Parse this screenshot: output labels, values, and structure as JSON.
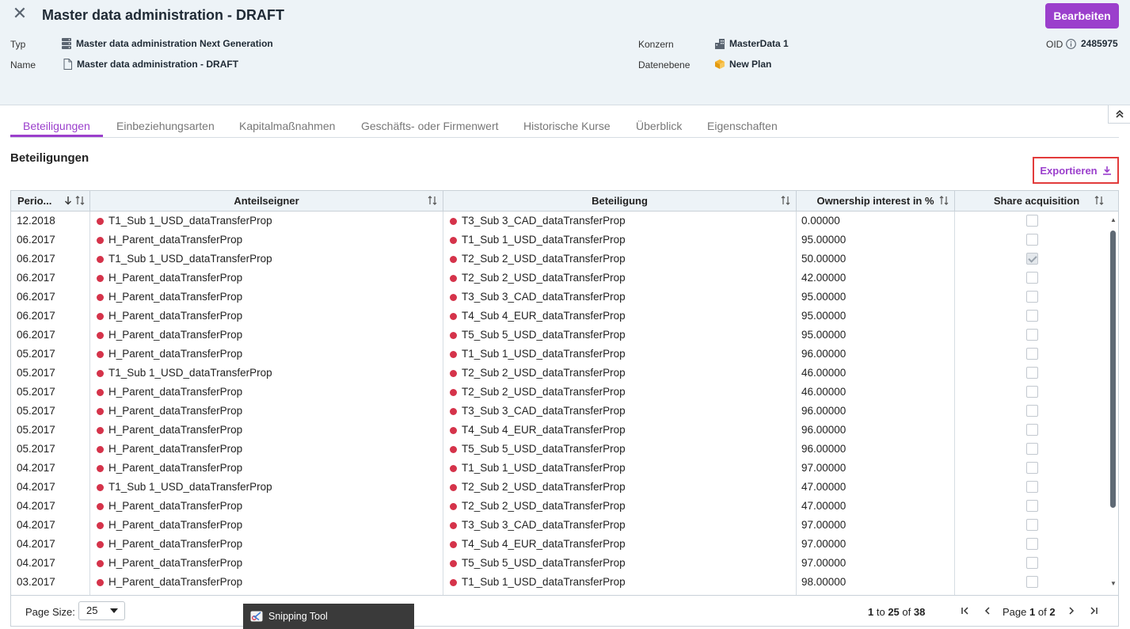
{
  "header": {
    "title": "Master data administration - DRAFT",
    "edit_button": "Bearbeiten",
    "meta": {
      "typ_label": "Typ",
      "typ_value": "Master data administration Next Generation",
      "name_label": "Name",
      "name_value": "Master data administration - DRAFT",
      "konzern_label": "Konzern",
      "konzern_value": "MasterData 1",
      "datenebene_label": "Datenebene",
      "datenebene_value": "New Plan",
      "oid_label": "OID",
      "oid_value": "2485975"
    }
  },
  "tabs": [
    "Beteiligungen",
    "Einbeziehungsarten",
    "Kapitalmaßnahmen",
    "Geschäfts- oder Firmenwert",
    "Historische Kurse",
    "Überblick",
    "Eigenschaften"
  ],
  "active_tab": "Beteiligungen",
  "section_title": "Beteiligungen",
  "export_label": "Exportieren",
  "grid": {
    "columns": [
      "Perio...",
      "Anteilseigner",
      "Beteiligung",
      "Ownership interest in %",
      "Share acquisition"
    ],
    "rows": [
      {
        "period": "12.2018",
        "owner": "T1_Sub 1_USD_dataTransferProp",
        "holding": "T3_Sub 3_CAD_dataTransferProp",
        "pct": "0.00000",
        "acq": false
      },
      {
        "period": "06.2017",
        "owner": "H_Parent_dataTransferProp",
        "holding": "T1_Sub 1_USD_dataTransferProp",
        "pct": "95.00000",
        "acq": false
      },
      {
        "period": "06.2017",
        "owner": "T1_Sub 1_USD_dataTransferProp",
        "holding": "T2_Sub 2_USD_dataTransferProp",
        "pct": "50.00000",
        "acq": true
      },
      {
        "period": "06.2017",
        "owner": "H_Parent_dataTransferProp",
        "holding": "T2_Sub 2_USD_dataTransferProp",
        "pct": "42.00000",
        "acq": false
      },
      {
        "period": "06.2017",
        "owner": "H_Parent_dataTransferProp",
        "holding": "T3_Sub 3_CAD_dataTransferProp",
        "pct": "95.00000",
        "acq": false
      },
      {
        "period": "06.2017",
        "owner": "H_Parent_dataTransferProp",
        "holding": "T4_Sub 4_EUR_dataTransferProp",
        "pct": "95.00000",
        "acq": false
      },
      {
        "period": "06.2017",
        "owner": "H_Parent_dataTransferProp",
        "holding": "T5_Sub 5_USD_dataTransferProp",
        "pct": "95.00000",
        "acq": false
      },
      {
        "period": "05.2017",
        "owner": "H_Parent_dataTransferProp",
        "holding": "T1_Sub 1_USD_dataTransferProp",
        "pct": "96.00000",
        "acq": false
      },
      {
        "period": "05.2017",
        "owner": "T1_Sub 1_USD_dataTransferProp",
        "holding": "T2_Sub 2_USD_dataTransferProp",
        "pct": "46.00000",
        "acq": false
      },
      {
        "period": "05.2017",
        "owner": "H_Parent_dataTransferProp",
        "holding": "T2_Sub 2_USD_dataTransferProp",
        "pct": "46.00000",
        "acq": false
      },
      {
        "period": "05.2017",
        "owner": "H_Parent_dataTransferProp",
        "holding": "T3_Sub 3_CAD_dataTransferProp",
        "pct": "96.00000",
        "acq": false
      },
      {
        "period": "05.2017",
        "owner": "H_Parent_dataTransferProp",
        "holding": "T4_Sub 4_EUR_dataTransferProp",
        "pct": "96.00000",
        "acq": false
      },
      {
        "period": "05.2017",
        "owner": "H_Parent_dataTransferProp",
        "holding": "T5_Sub 5_USD_dataTransferProp",
        "pct": "96.00000",
        "acq": false
      },
      {
        "period": "04.2017",
        "owner": "H_Parent_dataTransferProp",
        "holding": "T1_Sub 1_USD_dataTransferProp",
        "pct": "97.00000",
        "acq": false
      },
      {
        "period": "04.2017",
        "owner": "T1_Sub 1_USD_dataTransferProp",
        "holding": "T2_Sub 2_USD_dataTransferProp",
        "pct": "47.00000",
        "acq": false
      },
      {
        "period": "04.2017",
        "owner": "H_Parent_dataTransferProp",
        "holding": "T2_Sub 2_USD_dataTransferProp",
        "pct": "47.00000",
        "acq": false
      },
      {
        "period": "04.2017",
        "owner": "H_Parent_dataTransferProp",
        "holding": "T3_Sub 3_CAD_dataTransferProp",
        "pct": "97.00000",
        "acq": false
      },
      {
        "period": "04.2017",
        "owner": "H_Parent_dataTransferProp",
        "holding": "T4_Sub 4_EUR_dataTransferProp",
        "pct": "97.00000",
        "acq": false
      },
      {
        "period": "04.2017",
        "owner": "H_Parent_dataTransferProp",
        "holding": "T5_Sub 5_USD_dataTransferProp",
        "pct": "97.00000",
        "acq": false
      },
      {
        "period": "03.2017",
        "owner": "H_Parent_dataTransferProp",
        "holding": "T1_Sub 1_USD_dataTransferProp",
        "pct": "98.00000",
        "acq": false
      }
    ]
  },
  "pagination": {
    "page_size_label": "Page Size:",
    "page_size": "25",
    "range_from": "1",
    "range_to_word": "to",
    "range_to": "25",
    "range_of_word": "of",
    "total": "38",
    "page_word": "Page",
    "page_current": "1",
    "page_of_word": "of",
    "page_total": "2"
  },
  "taskbar_label": "Snipping Tool",
  "colors": {
    "accent": "#9b3fcc",
    "header_bg": "#edf3f7",
    "entity_dot": "#d5334a",
    "highlight_border": "#e23b3b"
  },
  "icons": {
    "typ": "server-icon",
    "name": "document-icon",
    "konzern": "building-icon",
    "datenebene": "cube-icon",
    "oid": "info-icon",
    "export": "download-icon"
  }
}
